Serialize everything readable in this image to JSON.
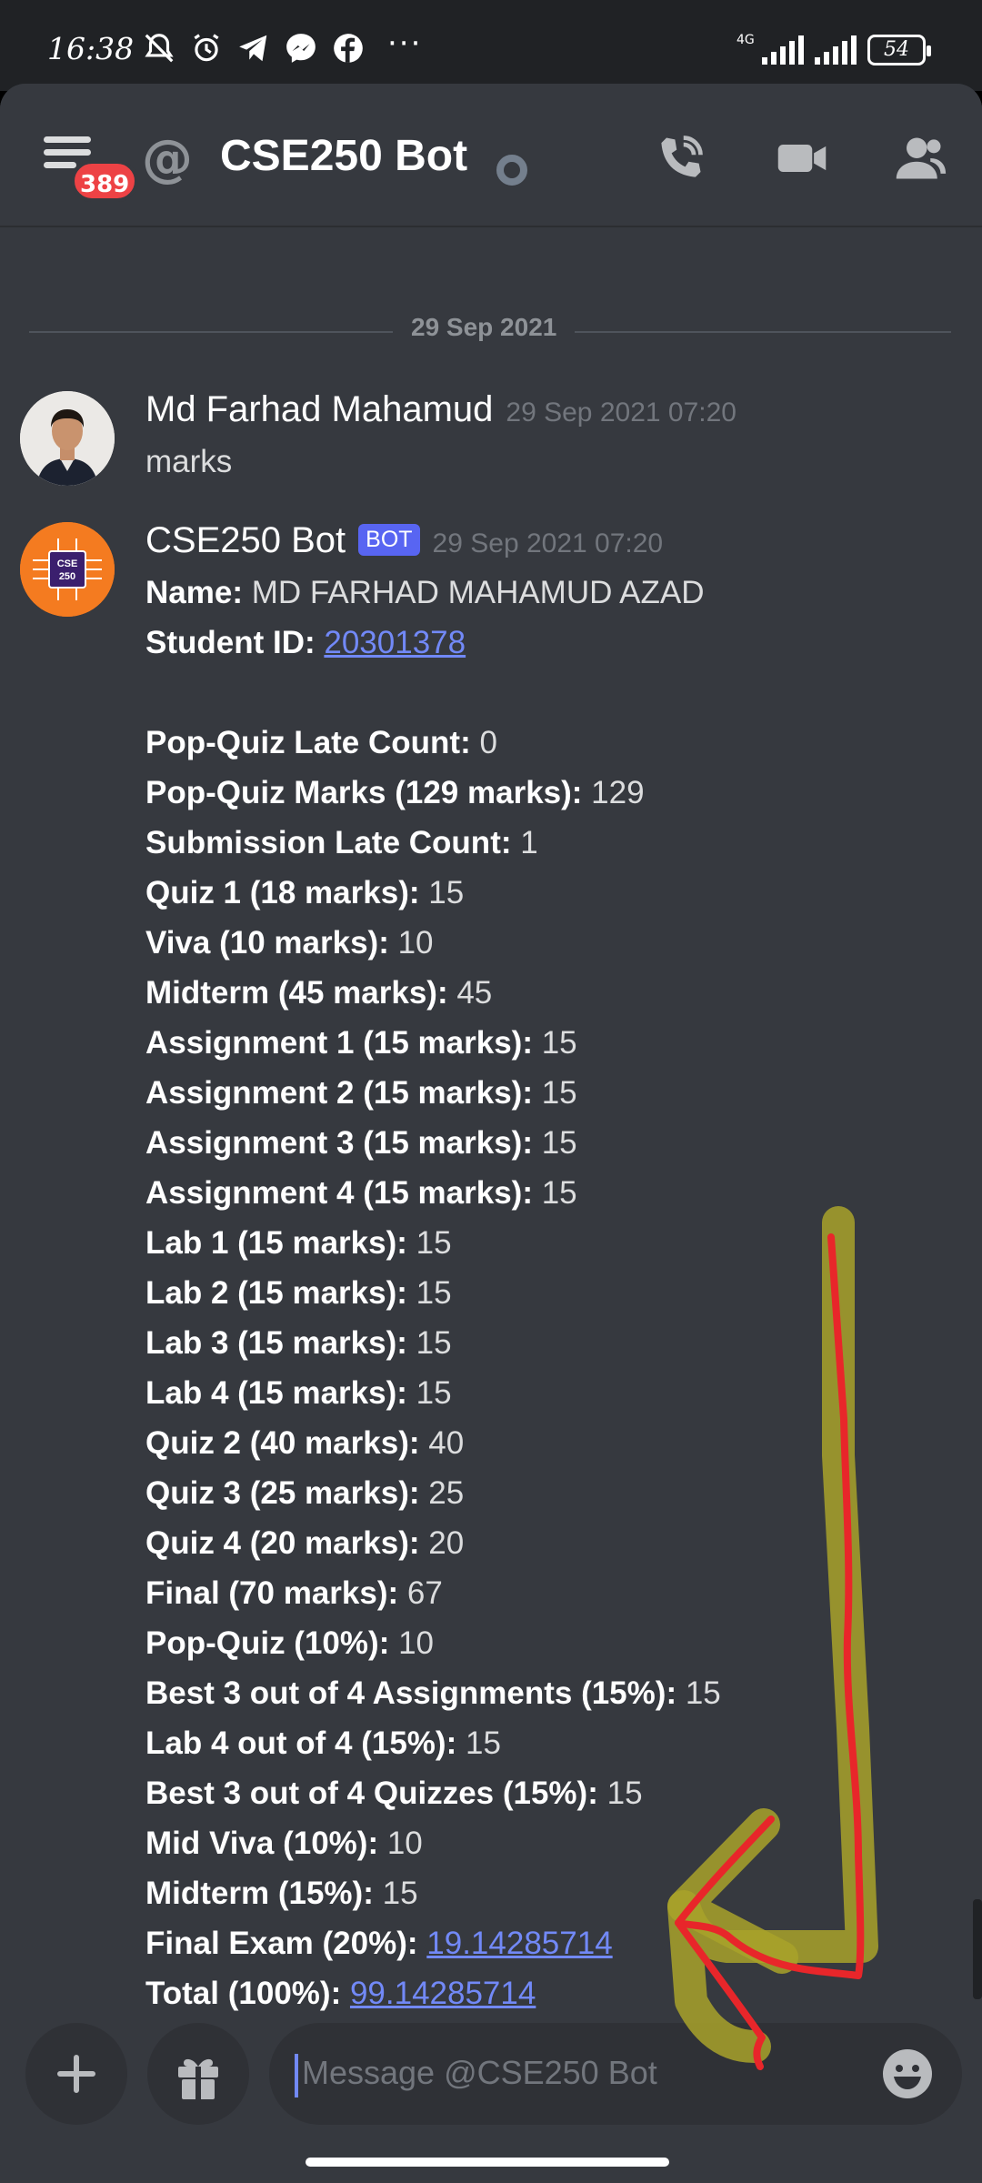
{
  "status_bar": {
    "time": "16:38",
    "network": "4G",
    "battery": "54",
    "more": "···"
  },
  "header": {
    "notification_count": "389",
    "channel_name": "CSE250 Bot"
  },
  "chat": {
    "date_divider": "29 Sep 2021",
    "messages": [
      {
        "author": "Md Farhad Mahamud",
        "timestamp": "29 Sep 2021 07:20",
        "text": "marks"
      },
      {
        "author": "CSE250 Bot",
        "bot_tag": "BOT",
        "timestamp": "29 Sep 2021 07:20",
        "avatar_text_top": "CSE",
        "avatar_text_bottom": "250"
      }
    ],
    "report": {
      "name_label": "Name:",
      "name_value": "MD FARHAD MAHAMUD AZAD",
      "id_label": "Student ID:",
      "id_value": "20301378",
      "rows": [
        {
          "label": "Pop-Quiz Late Count",
          "value": "0"
        },
        {
          "label": "Pop-Quiz Marks (129 marks)",
          "value": "129"
        },
        {
          "label": "Submission Late Count",
          "value": "1"
        },
        {
          "label": "Quiz 1 (18 marks)",
          "value": "15"
        },
        {
          "label": "Viva (10 marks)",
          "value": "10"
        },
        {
          "label": "Midterm (45 marks)",
          "value": "45"
        },
        {
          "label": "Assignment 1 (15 marks)",
          "value": "15"
        },
        {
          "label": "Assignment 2 (15 marks)",
          "value": "15"
        },
        {
          "label": "Assignment 3 (15 marks)",
          "value": "15"
        },
        {
          "label": "Assignment 4 (15 marks)",
          "value": "15"
        },
        {
          "label": "Lab 1 (15 marks)",
          "value": "15"
        },
        {
          "label": "Lab 2 (15 marks)",
          "value": "15"
        },
        {
          "label": "Lab 3 (15 marks)",
          "value": "15"
        },
        {
          "label": "Lab 4 (15 marks)",
          "value": "15"
        },
        {
          "label": "Quiz 2 (40 marks)",
          "value": "40"
        },
        {
          "label": "Quiz 3 (25 marks)",
          "value": "25"
        },
        {
          "label": "Quiz 4 (20 marks)",
          "value": "20"
        },
        {
          "label": "Final (70 marks)",
          "value": "67"
        },
        {
          "label": "Pop-Quiz (10%)",
          "value": "10"
        },
        {
          "label": "Best 3 out of 4 Assignments (15%)",
          "value": "15"
        },
        {
          "label": "Lab 4 out of 4 (15%)",
          "value": "15"
        },
        {
          "label": "Best 3 out of 4 Quizzes (15%)",
          "value": "15"
        },
        {
          "label": "Mid Viva (10%)",
          "value": "10"
        },
        {
          "label": "Midterm (15%)",
          "value": "15"
        }
      ],
      "final_exam_label": "Final Exam (20%)",
      "final_exam_value": "19.14285714",
      "total_label": "Total (100%)",
      "total_value": "99.14285714"
    }
  },
  "composer": {
    "placeholder": "Message @CSE250 Bot"
  },
  "colors": {
    "background": "#36393f",
    "link": "#7289f7",
    "badge": "#ed4245",
    "annotation_red": "#e8262a",
    "annotation_olive": "#a8a22a"
  }
}
